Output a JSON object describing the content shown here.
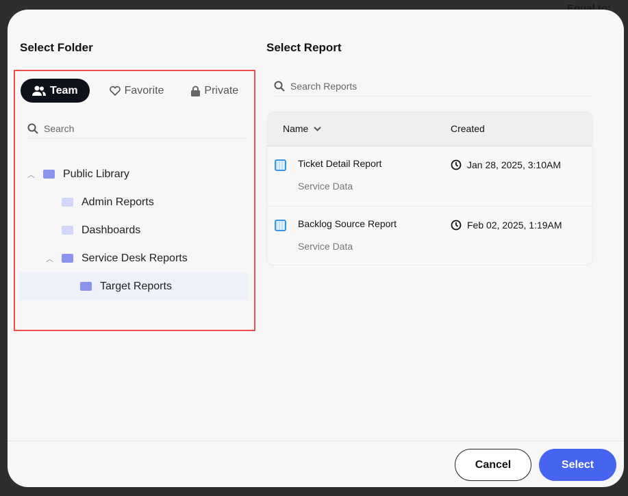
{
  "background": {
    "text": "Equal to:"
  },
  "folder_panel": {
    "title": "Select Folder",
    "tabs": [
      {
        "label": "Team",
        "icon": "users-icon",
        "active": true
      },
      {
        "label": "Favorite",
        "icon": "heart-icon",
        "active": false
      },
      {
        "label": "Private",
        "icon": "lock-icon",
        "active": false
      }
    ],
    "search_placeholder": "Search",
    "tree": [
      {
        "label": "Public Library",
        "level": 0,
        "expanded": true
      },
      {
        "label": "Admin Reports",
        "level": 1
      },
      {
        "label": "Dashboards",
        "level": 1
      },
      {
        "label": "Service Desk Reports",
        "level": 1,
        "expanded": true
      },
      {
        "label": "Target Reports",
        "level": 2,
        "selected": true
      }
    ]
  },
  "report_panel": {
    "title": "Select Report",
    "search_placeholder": "Search Reports",
    "columns": {
      "name": "Name",
      "created": "Created"
    },
    "rows": [
      {
        "name": "Ticket Detail Report",
        "source": "Service Data",
        "created": "Jan 28, 2025, 3:10AM"
      },
      {
        "name": "Backlog Source Report",
        "source": "Service Data",
        "created": "Feb 02, 2025, 1:19AM"
      }
    ]
  },
  "footer": {
    "cancel_label": "Cancel",
    "select_label": "Select"
  },
  "colors": {
    "accent": "#4664f0",
    "highlight_border": "#ef4b4b",
    "folder": "#8b93ec"
  }
}
